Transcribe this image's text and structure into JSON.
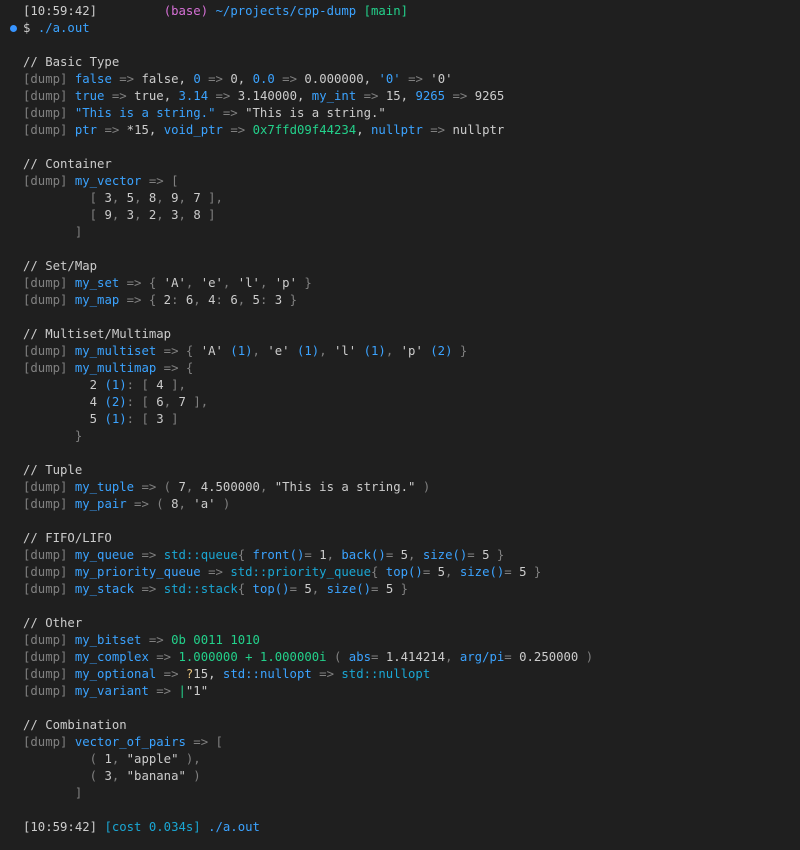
{
  "colors": {
    "background": "#1f1f1f",
    "text": "#cccccc",
    "dim": "#808080",
    "blue": "#3ba3ff",
    "cyan": "#1aa7d4",
    "green": "#23d18b",
    "magenta": "#d670d6",
    "yellow": "#e5c07b",
    "prompt_dot": "#3794ff"
  },
  "lines": [
    [
      {
        "t": "[10:59:42]",
        "c": "text"
      },
      {
        "t": "         ",
        "c": "text"
      },
      {
        "t": "(base) ",
        "c": "magenta"
      },
      {
        "t": "~/projects/cpp-dump ",
        "c": "blue"
      },
      {
        "t": "[main]",
        "c": "green"
      }
    ],
    [
      {
        "t": "$ ",
        "c": "text"
      },
      {
        "t": "./a.out",
        "c": "blue"
      }
    ],
    [],
    [
      {
        "t": "// Basic Type",
        "c": "text"
      }
    ],
    [
      {
        "t": "[dump] ",
        "c": "dim"
      },
      {
        "t": "false",
        "c": "blue"
      },
      {
        "t": " => ",
        "c": "dim"
      },
      {
        "t": "false, ",
        "c": "text"
      },
      {
        "t": "0",
        "c": "blue"
      },
      {
        "t": " => ",
        "c": "dim"
      },
      {
        "t": "0, ",
        "c": "text"
      },
      {
        "t": "0.0",
        "c": "blue"
      },
      {
        "t": " => ",
        "c": "dim"
      },
      {
        "t": "0.000000, ",
        "c": "text"
      },
      {
        "t": "'0'",
        "c": "blue"
      },
      {
        "t": " => ",
        "c": "dim"
      },
      {
        "t": "'0'",
        "c": "text"
      }
    ],
    [
      {
        "t": "[dump] ",
        "c": "dim"
      },
      {
        "t": "true",
        "c": "blue"
      },
      {
        "t": " => ",
        "c": "dim"
      },
      {
        "t": "true, ",
        "c": "text"
      },
      {
        "t": "3.14",
        "c": "blue"
      },
      {
        "t": " => ",
        "c": "dim"
      },
      {
        "t": "3.140000, ",
        "c": "text"
      },
      {
        "t": "my_int",
        "c": "blue"
      },
      {
        "t": " => ",
        "c": "dim"
      },
      {
        "t": "15, ",
        "c": "text"
      },
      {
        "t": "9265",
        "c": "blue"
      },
      {
        "t": " => ",
        "c": "dim"
      },
      {
        "t": "9265",
        "c": "text"
      }
    ],
    [
      {
        "t": "[dump] ",
        "c": "dim"
      },
      {
        "t": "\"This is a string.\"",
        "c": "blue"
      },
      {
        "t": " => ",
        "c": "dim"
      },
      {
        "t": "\"This is a string.\"",
        "c": "text"
      }
    ],
    [
      {
        "t": "[dump] ",
        "c": "dim"
      },
      {
        "t": "ptr",
        "c": "blue"
      },
      {
        "t": " => ",
        "c": "dim"
      },
      {
        "t": "*15, ",
        "c": "text"
      },
      {
        "t": "void_ptr",
        "c": "blue"
      },
      {
        "t": " => ",
        "c": "dim"
      },
      {
        "t": "0x7ffd09f44234",
        "c": "green"
      },
      {
        "t": ", ",
        "c": "text"
      },
      {
        "t": "nullptr",
        "c": "blue"
      },
      {
        "t": " => ",
        "c": "dim"
      },
      {
        "t": "nullptr",
        "c": "text"
      }
    ],
    [],
    [
      {
        "t": "// Container",
        "c": "text"
      }
    ],
    [
      {
        "t": "[dump] ",
        "c": "dim"
      },
      {
        "t": "my_vector",
        "c": "blue"
      },
      {
        "t": " => [",
        "c": "dim"
      }
    ],
    [
      {
        "t": "         [ ",
        "c": "dim"
      },
      {
        "t": "3",
        "c": "text"
      },
      {
        "t": ", ",
        "c": "dim"
      },
      {
        "t": "5",
        "c": "text"
      },
      {
        "t": ", ",
        "c": "dim"
      },
      {
        "t": "8",
        "c": "text"
      },
      {
        "t": ", ",
        "c": "dim"
      },
      {
        "t": "9",
        "c": "text"
      },
      {
        "t": ", ",
        "c": "dim"
      },
      {
        "t": "7",
        "c": "text"
      },
      {
        "t": " ],",
        "c": "dim"
      }
    ],
    [
      {
        "t": "         [ ",
        "c": "dim"
      },
      {
        "t": "9",
        "c": "text"
      },
      {
        "t": ", ",
        "c": "dim"
      },
      {
        "t": "3",
        "c": "text"
      },
      {
        "t": ", ",
        "c": "dim"
      },
      {
        "t": "2",
        "c": "text"
      },
      {
        "t": ", ",
        "c": "dim"
      },
      {
        "t": "3",
        "c": "text"
      },
      {
        "t": ", ",
        "c": "dim"
      },
      {
        "t": "8",
        "c": "text"
      },
      {
        "t": " ]",
        "c": "dim"
      }
    ],
    [
      {
        "t": "       ]",
        "c": "dim"
      }
    ],
    [],
    [
      {
        "t": "// Set/Map",
        "c": "text"
      }
    ],
    [
      {
        "t": "[dump] ",
        "c": "dim"
      },
      {
        "t": "my_set",
        "c": "blue"
      },
      {
        "t": " => { ",
        "c": "dim"
      },
      {
        "t": "'A'",
        "c": "text"
      },
      {
        "t": ", ",
        "c": "dim"
      },
      {
        "t": "'e'",
        "c": "text"
      },
      {
        "t": ", ",
        "c": "dim"
      },
      {
        "t": "'l'",
        "c": "text"
      },
      {
        "t": ", ",
        "c": "dim"
      },
      {
        "t": "'p'",
        "c": "text"
      },
      {
        "t": " }",
        "c": "dim"
      }
    ],
    [
      {
        "t": "[dump] ",
        "c": "dim"
      },
      {
        "t": "my_map",
        "c": "blue"
      },
      {
        "t": " => { ",
        "c": "dim"
      },
      {
        "t": "2",
        "c": "text"
      },
      {
        "t": ": ",
        "c": "dim"
      },
      {
        "t": "6",
        "c": "text"
      },
      {
        "t": ", ",
        "c": "dim"
      },
      {
        "t": "4",
        "c": "text"
      },
      {
        "t": ": ",
        "c": "dim"
      },
      {
        "t": "6",
        "c": "text"
      },
      {
        "t": ", ",
        "c": "dim"
      },
      {
        "t": "5",
        "c": "text"
      },
      {
        "t": ": ",
        "c": "dim"
      },
      {
        "t": "3",
        "c": "text"
      },
      {
        "t": " }",
        "c": "dim"
      }
    ],
    [],
    [
      {
        "t": "// Multiset/Multimap",
        "c": "text"
      }
    ],
    [
      {
        "t": "[dump] ",
        "c": "dim"
      },
      {
        "t": "my_multiset",
        "c": "blue"
      },
      {
        "t": " => { ",
        "c": "dim"
      },
      {
        "t": "'A'",
        "c": "text"
      },
      {
        "t": " (1)",
        "c": "blue"
      },
      {
        "t": ", ",
        "c": "dim"
      },
      {
        "t": "'e'",
        "c": "text"
      },
      {
        "t": " (1)",
        "c": "blue"
      },
      {
        "t": ", ",
        "c": "dim"
      },
      {
        "t": "'l'",
        "c": "text"
      },
      {
        "t": " (1)",
        "c": "blue"
      },
      {
        "t": ", ",
        "c": "dim"
      },
      {
        "t": "'p'",
        "c": "text"
      },
      {
        "t": " (2)",
        "c": "blue"
      },
      {
        "t": " }",
        "c": "dim"
      }
    ],
    [
      {
        "t": "[dump] ",
        "c": "dim"
      },
      {
        "t": "my_multimap",
        "c": "blue"
      },
      {
        "t": " => {",
        "c": "dim"
      }
    ],
    [
      {
        "t": "         2",
        "c": "text"
      },
      {
        "t": " (1)",
        "c": "blue"
      },
      {
        "t": ": [ ",
        "c": "dim"
      },
      {
        "t": "4",
        "c": "text"
      },
      {
        "t": " ],",
        "c": "dim"
      }
    ],
    [
      {
        "t": "         4",
        "c": "text"
      },
      {
        "t": " (2)",
        "c": "blue"
      },
      {
        "t": ": [ ",
        "c": "dim"
      },
      {
        "t": "6",
        "c": "text"
      },
      {
        "t": ", ",
        "c": "dim"
      },
      {
        "t": "7",
        "c": "text"
      },
      {
        "t": " ],",
        "c": "dim"
      }
    ],
    [
      {
        "t": "         5",
        "c": "text"
      },
      {
        "t": " (1)",
        "c": "blue"
      },
      {
        "t": ": [ ",
        "c": "dim"
      },
      {
        "t": "3",
        "c": "text"
      },
      {
        "t": " ]",
        "c": "dim"
      }
    ],
    [
      {
        "t": "       }",
        "c": "dim"
      }
    ],
    [],
    [
      {
        "t": "// Tuple",
        "c": "text"
      }
    ],
    [
      {
        "t": "[dump] ",
        "c": "dim"
      },
      {
        "t": "my_tuple",
        "c": "blue"
      },
      {
        "t": " => ( ",
        "c": "dim"
      },
      {
        "t": "7",
        "c": "text"
      },
      {
        "t": ", ",
        "c": "dim"
      },
      {
        "t": "4.500000",
        "c": "text"
      },
      {
        "t": ", ",
        "c": "dim"
      },
      {
        "t": "\"This is a string.\"",
        "c": "text"
      },
      {
        "t": " )",
        "c": "dim"
      }
    ],
    [
      {
        "t": "[dump] ",
        "c": "dim"
      },
      {
        "t": "my_pair",
        "c": "blue"
      },
      {
        "t": " => ( ",
        "c": "dim"
      },
      {
        "t": "8",
        "c": "text"
      },
      {
        "t": ", ",
        "c": "dim"
      },
      {
        "t": "'a'",
        "c": "text"
      },
      {
        "t": " )",
        "c": "dim"
      }
    ],
    [],
    [
      {
        "t": "// FIFO/LIFO",
        "c": "text"
      }
    ],
    [
      {
        "t": "[dump] ",
        "c": "dim"
      },
      {
        "t": "my_queue",
        "c": "blue"
      },
      {
        "t": " => ",
        "c": "dim"
      },
      {
        "t": "std::queue",
        "c": "cyan"
      },
      {
        "t": "{ ",
        "c": "dim"
      },
      {
        "t": "front()",
        "c": "blue"
      },
      {
        "t": "= ",
        "c": "dim"
      },
      {
        "t": "1",
        "c": "text"
      },
      {
        "t": ", ",
        "c": "dim"
      },
      {
        "t": "back()",
        "c": "blue"
      },
      {
        "t": "= ",
        "c": "dim"
      },
      {
        "t": "5",
        "c": "text"
      },
      {
        "t": ", ",
        "c": "dim"
      },
      {
        "t": "size()",
        "c": "blue"
      },
      {
        "t": "= ",
        "c": "dim"
      },
      {
        "t": "5",
        "c": "text"
      },
      {
        "t": " }",
        "c": "dim"
      }
    ],
    [
      {
        "t": "[dump] ",
        "c": "dim"
      },
      {
        "t": "my_priority_queue",
        "c": "blue"
      },
      {
        "t": " => ",
        "c": "dim"
      },
      {
        "t": "std::priority_queue",
        "c": "cyan"
      },
      {
        "t": "{ ",
        "c": "dim"
      },
      {
        "t": "top()",
        "c": "blue"
      },
      {
        "t": "= ",
        "c": "dim"
      },
      {
        "t": "5",
        "c": "text"
      },
      {
        "t": ", ",
        "c": "dim"
      },
      {
        "t": "size()",
        "c": "blue"
      },
      {
        "t": "= ",
        "c": "dim"
      },
      {
        "t": "5",
        "c": "text"
      },
      {
        "t": " }",
        "c": "dim"
      }
    ],
    [
      {
        "t": "[dump] ",
        "c": "dim"
      },
      {
        "t": "my_stack",
        "c": "blue"
      },
      {
        "t": " => ",
        "c": "dim"
      },
      {
        "t": "std::stack",
        "c": "cyan"
      },
      {
        "t": "{ ",
        "c": "dim"
      },
      {
        "t": "top()",
        "c": "blue"
      },
      {
        "t": "= ",
        "c": "dim"
      },
      {
        "t": "5",
        "c": "text"
      },
      {
        "t": ", ",
        "c": "dim"
      },
      {
        "t": "size()",
        "c": "blue"
      },
      {
        "t": "= ",
        "c": "dim"
      },
      {
        "t": "5",
        "c": "text"
      },
      {
        "t": " }",
        "c": "dim"
      }
    ],
    [],
    [
      {
        "t": "// Other",
        "c": "text"
      }
    ],
    [
      {
        "t": "[dump] ",
        "c": "dim"
      },
      {
        "t": "my_bitset",
        "c": "blue"
      },
      {
        "t": " => ",
        "c": "dim"
      },
      {
        "t": "0b 0011 1010",
        "c": "green"
      }
    ],
    [
      {
        "t": "[dump] ",
        "c": "dim"
      },
      {
        "t": "my_complex",
        "c": "blue"
      },
      {
        "t": " => ",
        "c": "dim"
      },
      {
        "t": "1.000000 + 1.000000i",
        "c": "green"
      },
      {
        "t": " ( ",
        "c": "dim"
      },
      {
        "t": "abs",
        "c": "blue"
      },
      {
        "t": "= ",
        "c": "dim"
      },
      {
        "t": "1.414214",
        "c": "text"
      },
      {
        "t": ", ",
        "c": "dim"
      },
      {
        "t": "arg/pi",
        "c": "blue"
      },
      {
        "t": "= ",
        "c": "dim"
      },
      {
        "t": "0.250000",
        "c": "text"
      },
      {
        "t": " )",
        "c": "dim"
      }
    ],
    [
      {
        "t": "[dump] ",
        "c": "dim"
      },
      {
        "t": "my_optional",
        "c": "blue"
      },
      {
        "t": " => ",
        "c": "dim"
      },
      {
        "t": "?",
        "c": "yellow"
      },
      {
        "t": "15, ",
        "c": "text"
      },
      {
        "t": "std::nullopt",
        "c": "blue"
      },
      {
        "t": " => ",
        "c": "dim"
      },
      {
        "t": "std::nullopt",
        "c": "cyan"
      }
    ],
    [
      {
        "t": "[dump] ",
        "c": "dim"
      },
      {
        "t": "my_variant",
        "c": "blue"
      },
      {
        "t": " => ",
        "c": "dim"
      },
      {
        "t": "|",
        "c": "green"
      },
      {
        "t": "\"1\"",
        "c": "text"
      }
    ],
    [],
    [
      {
        "t": "// Combination",
        "c": "text"
      }
    ],
    [
      {
        "t": "[dump] ",
        "c": "dim"
      },
      {
        "t": "vector_of_pairs",
        "c": "blue"
      },
      {
        "t": " => [",
        "c": "dim"
      }
    ],
    [
      {
        "t": "         ( ",
        "c": "dim"
      },
      {
        "t": "1",
        "c": "text"
      },
      {
        "t": ", ",
        "c": "dim"
      },
      {
        "t": "\"apple\"",
        "c": "text"
      },
      {
        "t": " ),",
        "c": "dim"
      }
    ],
    [
      {
        "t": "         ( ",
        "c": "dim"
      },
      {
        "t": "3",
        "c": "text"
      },
      {
        "t": ", ",
        "c": "dim"
      },
      {
        "t": "\"banana\"",
        "c": "text"
      },
      {
        "t": " )",
        "c": "dim"
      }
    ],
    [
      {
        "t": "       ]",
        "c": "dim"
      }
    ],
    [],
    [
      {
        "t": "[10:59:42] ",
        "c": "text"
      },
      {
        "t": "[cost 0.034s] ",
        "c": "cyan"
      },
      {
        "t": "./a.out",
        "c": "blue"
      }
    ]
  ]
}
